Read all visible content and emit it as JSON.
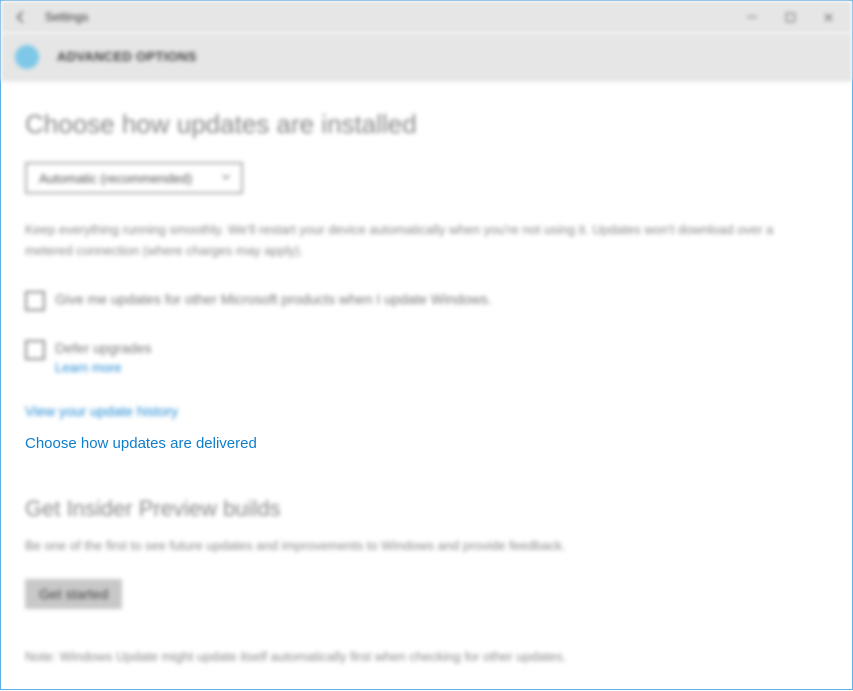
{
  "window": {
    "title": "Settings"
  },
  "header": {
    "title": "ADVANCED OPTIONS"
  },
  "section1": {
    "title": "Choose how updates are installed",
    "dropdown_selected": "Automatic (recommended)",
    "description": "Keep everything running smoothly. We'll restart your device automatically when you're not using it. Updates won't download over a metered connection (where charges may apply).",
    "checkbox1_label": "Give me updates for other Microsoft products when I update Windows.",
    "checkbox2_label": "Defer upgrades",
    "learn_more": "Learn more",
    "link_history": "View your update history",
    "link_delivery": "Choose how updates are delivered"
  },
  "section2": {
    "title": "Get Insider Preview builds",
    "description": "Be one of the first to see future updates and improvements to Windows and provide feedback.",
    "button": "Get started",
    "note": "Note: Windows Update might update itself automatically first when checking for other updates."
  }
}
